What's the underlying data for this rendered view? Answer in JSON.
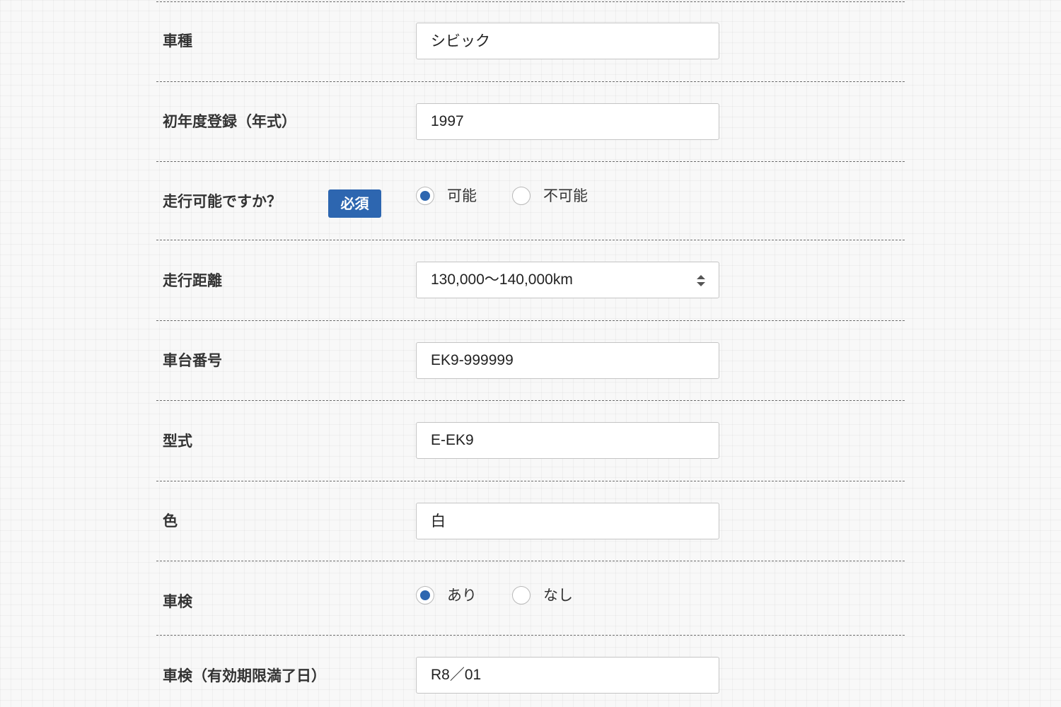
{
  "form": {
    "rows": [
      {
        "label": "車種",
        "value": "シビック"
      },
      {
        "label": "初年度登録（年式）",
        "value": "1997"
      },
      {
        "label": "走行可能ですか？",
        "badge": "必須",
        "options": [
          "可能",
          "不可能"
        ],
        "selected": "可能"
      },
      {
        "label": "走行距離",
        "value": "130,000〜140,000km"
      },
      {
        "label": "車台番号",
        "value": "EK9-999999"
      },
      {
        "label": "型式",
        "value": "E-EK9"
      },
      {
        "label": "色",
        "value": "白"
      },
      {
        "label": "車検",
        "options": [
          "あり",
          "なし"
        ],
        "selected": "あり"
      },
      {
        "label": "車検（有効期限満了日）",
        "value": "R8／01"
      }
    ]
  },
  "colors": {
    "accent": "#2d66b0",
    "divider": "#6b6b6b",
    "field_border": "#c4c4c4"
  }
}
